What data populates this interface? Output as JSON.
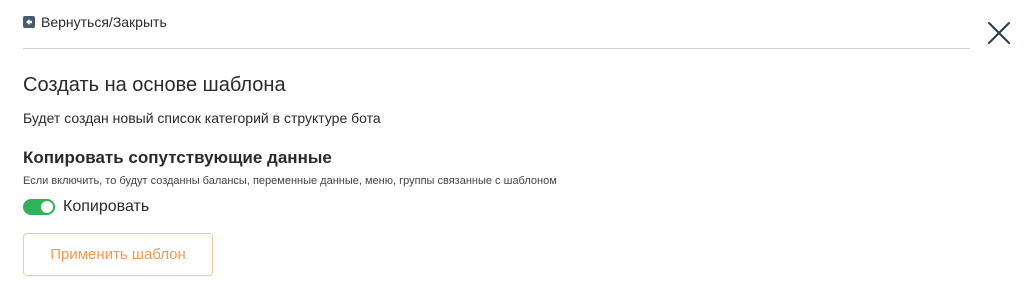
{
  "header": {
    "back_label": "Вернуться/Закрыть",
    "back_icon": "arrow-left-square-icon",
    "close_icon": "close-icon"
  },
  "main": {
    "title": "Создать на основе шаблона",
    "subtitle": "Будет создан новый список категорий в структуре бота",
    "copy_section": {
      "title": "Копировать сопутствующие данные",
      "description": "Если включить, то будут созданны балансы, переменные данные, меню, группы связанные с шаблоном",
      "toggle_label": "Копировать",
      "toggle_on": true
    },
    "apply_button_label": "Применить шаблон"
  },
  "colors": {
    "toggle_on": "#2fb25a",
    "apply_button_text": "#f09a55",
    "apply_button_border": "#f3c9a4",
    "close_icon": "#2b3a4a"
  }
}
